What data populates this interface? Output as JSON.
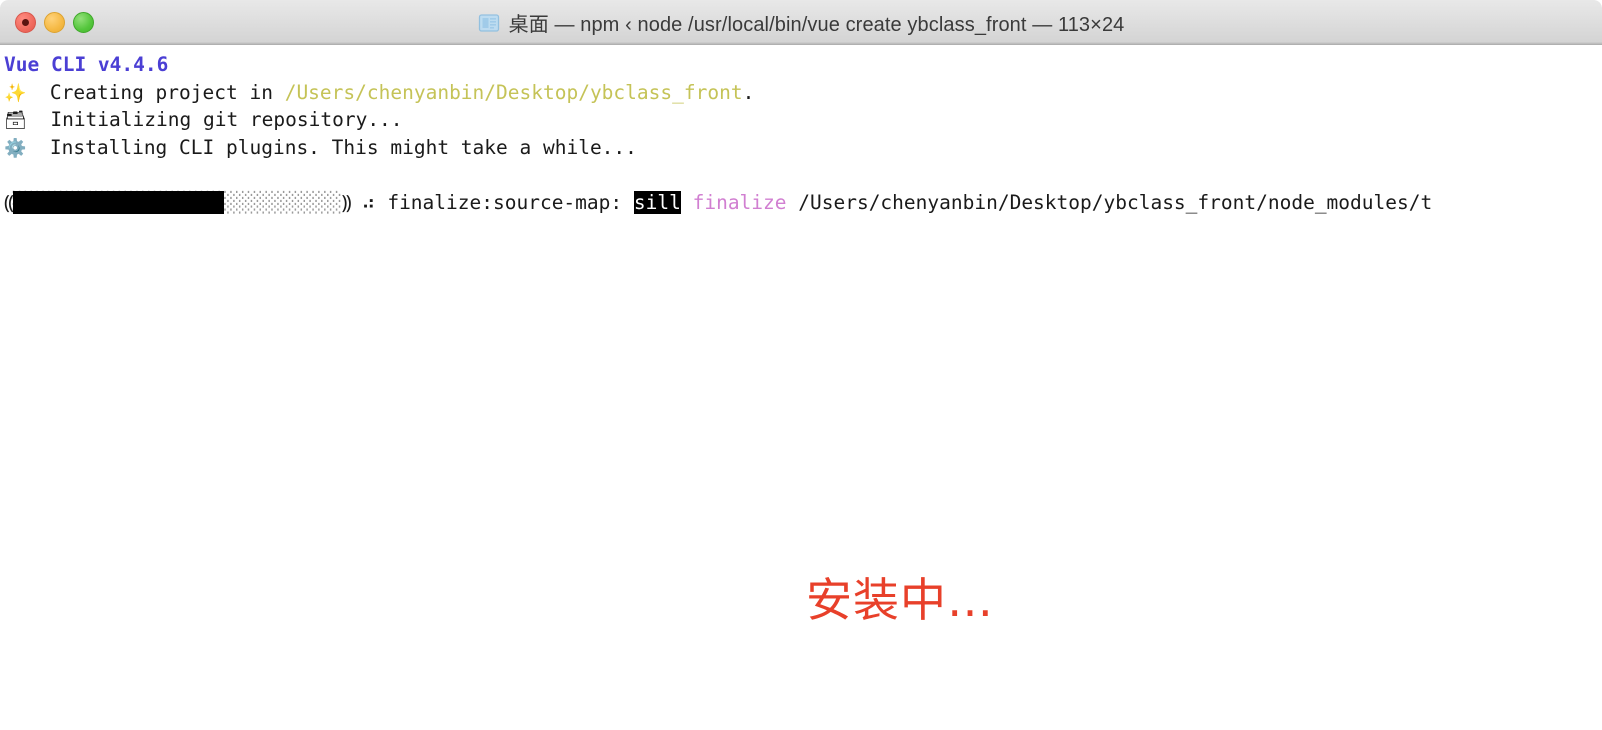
{
  "window": {
    "title": "桌面 — npm ‹ node /usr/local/bin/vue create ybclass_front — 113×24",
    "proxy_icon": "folder-document-icon",
    "traffic_lights": {
      "close_label": "close",
      "minimize_label": "minimize",
      "maximize_label": "maximize"
    },
    "colors": {
      "close": "#f06a5e",
      "minimize": "#f5b944",
      "maximize": "#54c63c",
      "titlebar_bg": "#e0e0e0",
      "body_bg": "#ffffff"
    }
  },
  "terminal": {
    "lines": [
      {
        "id": "line-vue-cli-version",
        "segments": [
          {
            "text": "Vue CLI v4.4.6",
            "style": "vue"
          }
        ]
      },
      {
        "id": "line-creating-project",
        "segments": [
          {
            "text": "✨",
            "style": "emoji",
            "icon": "sparkles-icon"
          },
          {
            "text": "  Creating project in ",
            "style": "default"
          },
          {
            "text": "/Users/chenyanbin/Desktop/ybclass_front",
            "style": "path"
          },
          {
            "text": ".",
            "style": "default"
          }
        ]
      },
      {
        "id": "line-initializing-git",
        "segments": [
          {
            "text": "🗃",
            "style": "emoji",
            "icon": "card-file-box-icon"
          },
          {
            "text": "  Initializing git repository...",
            "style": "default"
          }
        ]
      },
      {
        "id": "line-installing-plugins",
        "segments": [
          {
            "text": "⚙️",
            "style": "emoji",
            "icon": "gear-icon"
          },
          {
            "text": "  Installing CLI plugins. This might take a while...",
            "style": "default"
          }
        ]
      },
      {
        "id": "line-blank-1",
        "segments": []
      },
      {
        "id": "line-progress",
        "segments": [
          {
            "text": "⸨",
            "style": "bracket"
          },
          {
            "text": "░░░░░░░░░░░░░░░░░░",
            "style": "fill"
          },
          {
            "text": "░░░░░░░░░░",
            "style": "empty"
          },
          {
            "text": "⸩ ",
            "style": "bracket"
          },
          {
            "text": "⠴ ",
            "style": "default"
          },
          {
            "text": "finalize:source-map: ",
            "style": "default"
          },
          {
            "text": "sill",
            "style": "inverse"
          },
          {
            "text": " ",
            "style": "default"
          },
          {
            "text": "finalize",
            "style": "magenta"
          },
          {
            "text": " /Users/chenyanbin/Desktop/ybclass_front/node_modules/t",
            "style": "default"
          }
        ]
      }
    ]
  },
  "annotation": {
    "text": "安装中…",
    "color": "#e8402a"
  }
}
